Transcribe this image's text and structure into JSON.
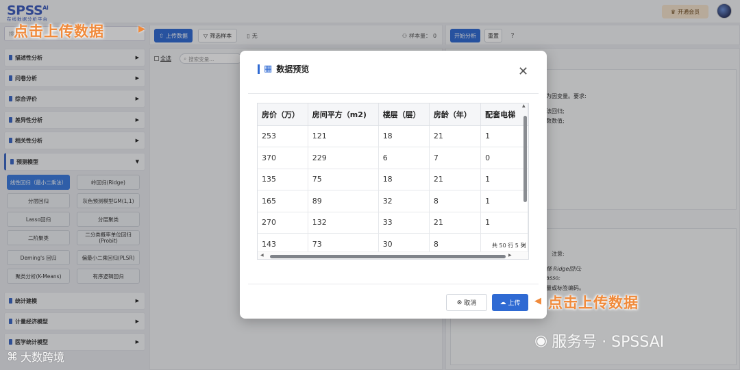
{
  "app": {
    "brand": "SPSS",
    "brand_suffix": "AI",
    "subtitle": "在线数据分析平台",
    "vip_label": "开通会员"
  },
  "sidebar": {
    "search_placeholder": "搜",
    "menu": [
      {
        "label": "描述性分析"
      },
      {
        "label": "问卷分析"
      },
      {
        "label": "综合评价"
      },
      {
        "label": "差异性分析"
      },
      {
        "label": "相关性分析"
      },
      {
        "label": "预测模型"
      },
      {
        "label": "统计建模"
      },
      {
        "label": "计量经济模型"
      },
      {
        "label": "医学统计模型"
      }
    ],
    "sub_buttons": [
      "线性回归（最小二乘法）",
      "岭回归(Ridge)",
      "分层回归",
      "灰色预测模型GM(1,1)",
      "Lasso回归",
      "分层聚类",
      "二阶聚类",
      "二分类概率单位回归 (Probit)",
      "Deming's 回归",
      "偏最小二乘回归(PLSR)",
      "聚类分析(K-Means)",
      "有序逻辑回归"
    ]
  },
  "toolbar": {
    "upload_label": "上传数据",
    "filter_label": "筛选样本",
    "file_label": "无",
    "sample_label": "样本量：",
    "sample_value": "0",
    "start_label": "开始分析",
    "reset_label": "重置"
  },
  "variables": {
    "select_all": "全选",
    "search_placeholder": "搜索变量..."
  },
  "right_panel": {
    "line1": "为因变量。要求:",
    "line2": "法回归;",
    "line3": "数数值;",
    "note": "注意:",
    "note1": "择 Ridge回归;",
    "note2": "asso;",
    "note3": "量或标签编码。"
  },
  "modal": {
    "title": "数据预览",
    "columns": [
      "房价（万）",
      "房间平方（m2)",
      "楼层（层）",
      "房龄（年）",
      "配套电梯"
    ],
    "rows": [
      [
        "253",
        "121",
        "18",
        "21",
        "1"
      ],
      [
        "370",
        "229",
        "6",
        "7",
        "0"
      ],
      [
        "135",
        "75",
        "18",
        "21",
        "1"
      ],
      [
        "165",
        "89",
        "32",
        "8",
        "1"
      ],
      [
        "270",
        "132",
        "33",
        "21",
        "1"
      ],
      [
        "143",
        "73",
        "30",
        "8",
        ""
      ]
    ],
    "row_count": "共 50 行 5 列",
    "cancel_label": "取消",
    "upload_label": "上传"
  },
  "annotations": {
    "top": "点击上传数据",
    "bottom": "点击上传数据"
  },
  "watermark": {
    "channel": "服务号 · SPSSAI",
    "source": "大数跨境"
  },
  "colors": {
    "primary": "#2f6ad3",
    "callout": "#f08a3b"
  }
}
